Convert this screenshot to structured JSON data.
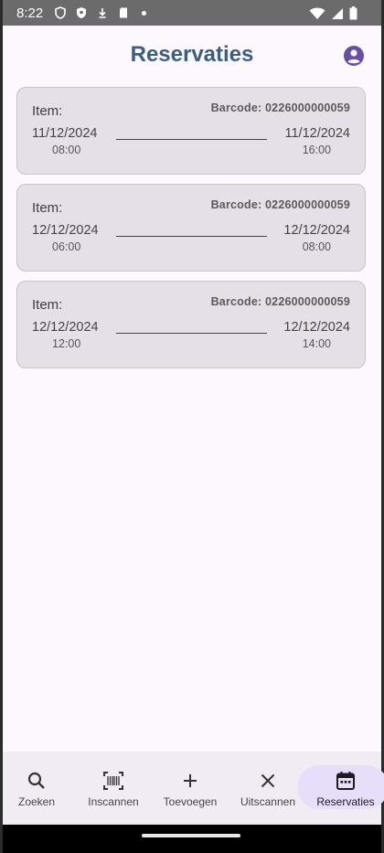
{
  "status_bar": {
    "time": "8:22"
  },
  "header": {
    "title": "Reservaties",
    "account_icon": "account-circle-icon",
    "accent_color": "#6750a4"
  },
  "reservations": [
    {
      "item_label": "Item:",
      "barcode": "Barcode: 0226000000059",
      "start_date": "11/12/2024",
      "start_time": "08:00",
      "end_date": "11/12/2024",
      "end_time": "16:00"
    },
    {
      "item_label": "Item:",
      "barcode": "Barcode: 0226000000059",
      "start_date": "12/12/2024",
      "start_time": "06:00",
      "end_date": "12/12/2024",
      "end_time": "08:00"
    },
    {
      "item_label": "Item:",
      "barcode": "Barcode: 0226000000059",
      "start_date": "12/12/2024",
      "start_time": "12:00",
      "end_date": "12/12/2024",
      "end_time": "14:00"
    }
  ],
  "bottom_nav": {
    "active": "Reservaties",
    "items": [
      {
        "label": "Zoeken",
        "icon": "search-icon"
      },
      {
        "label": "Inscannen",
        "icon": "barcode-scan-icon"
      },
      {
        "label": "Toevoegen",
        "icon": "plus-icon"
      },
      {
        "label": "Uitscannen",
        "icon": "close-icon"
      },
      {
        "label": "Reservaties",
        "icon": "calendar-icon"
      }
    ]
  }
}
